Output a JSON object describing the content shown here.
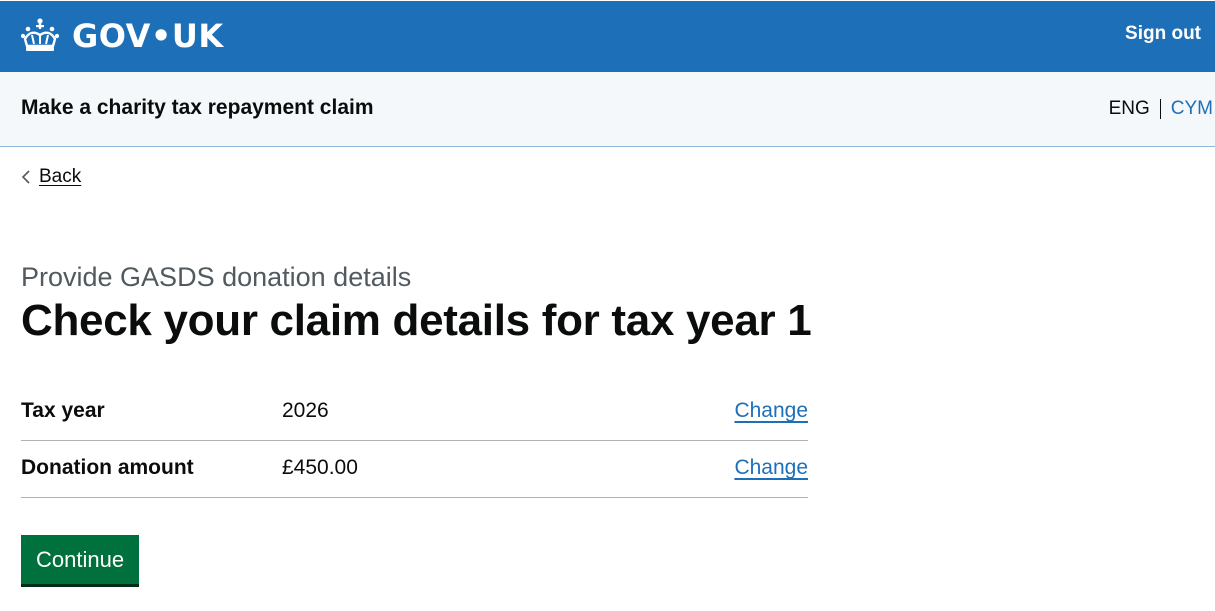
{
  "header": {
    "logo_text": "GOV•UK",
    "sign_out_label": "Sign out"
  },
  "service": {
    "name": "Make a charity tax repayment claim",
    "lang_current": "ENG",
    "lang_other": "CYM"
  },
  "nav": {
    "back_label": "Back"
  },
  "main": {
    "caption": "Provide GASDS donation details",
    "title": "Check your claim details for tax year 1",
    "summary": [
      {
        "key": "Tax year",
        "value": "2026",
        "action": "Change"
      },
      {
        "key": "Donation amount",
        "value": "£450.00",
        "action": "Change"
      }
    ],
    "continue_label": "Continue"
  },
  "icons": {
    "logo": "crown-icon",
    "back": "chevron-left-icon"
  },
  "colors": {
    "header_blue": "#1d70b8",
    "service_bar_bg": "#f4f8fb",
    "link_blue": "#1d70b8",
    "button_green": "#00703c",
    "caption_grey": "#505a5f",
    "text": "#0b0c0c"
  }
}
